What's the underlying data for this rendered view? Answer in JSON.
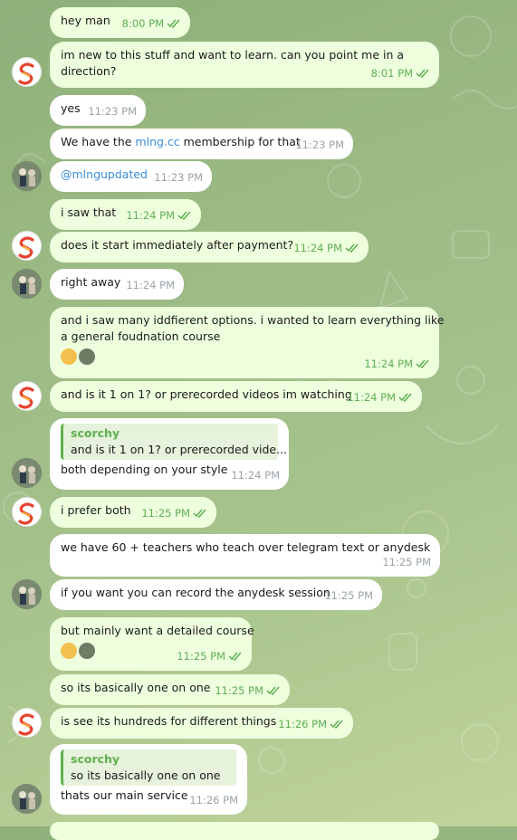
{
  "messages": [
    {
      "id": "m1",
      "dir": "out",
      "text": "hey man",
      "time": "8:00 PM"
    },
    {
      "id": "m2",
      "dir": "out",
      "text": "im new to this stuff and want to learn. can you point me in a direction?",
      "line1": "im new to this stuff and want to learn. can you point me in a",
      "line2": "direction?",
      "time": "8:01 PM"
    },
    {
      "id": "m3",
      "dir": "in",
      "text": "yes",
      "time": "11:23 PM"
    },
    {
      "id": "m4",
      "dir": "in",
      "pre": "We have the ",
      "link": "mlng.cc",
      "post": " membership for that",
      "time": "11:23 PM"
    },
    {
      "id": "m5",
      "dir": "in",
      "link": "@mlngupdated",
      "time": "11:23 PM"
    },
    {
      "id": "m6",
      "dir": "out",
      "text": "i saw that",
      "time": "11:24 PM"
    },
    {
      "id": "m7",
      "dir": "out",
      "text": "does it start immediately after payment?",
      "time": "11:24 PM"
    },
    {
      "id": "m8",
      "dir": "in",
      "text": "right away",
      "time": "11:24 PM"
    },
    {
      "id": "m9",
      "dir": "out",
      "line1": "and i saw many iddfierent options. i wanted to learn everything like",
      "line2": "a general foudnation course",
      "time": "11:24 PM"
    },
    {
      "id": "m10",
      "dir": "out",
      "text": "and is it 1 on 1? or prerecorded videos im watching",
      "time": "11:24 PM"
    },
    {
      "id": "m11",
      "dir": "in",
      "quote_name": "scorchy",
      "quote_text": "and is it 1 on 1? or prerecorded vide...",
      "text": "both depending on your style",
      "time": "11:24 PM"
    },
    {
      "id": "m12",
      "dir": "out",
      "text": "i prefer both",
      "time": "11:25 PM"
    },
    {
      "id": "m13",
      "dir": "in",
      "text": "we have 60 + teachers who teach over telegram text or anydesk",
      "time": "11:25 PM"
    },
    {
      "id": "m14",
      "dir": "in",
      "text": "if you want you can record the anydesk session",
      "time": "11:25 PM"
    },
    {
      "id": "m15",
      "dir": "out",
      "text": "but mainly want a detailed course",
      "time": "11:25 PM"
    },
    {
      "id": "m16",
      "dir": "out",
      "text": "so its basically one on one",
      "time": "11:25 PM"
    },
    {
      "id": "m17",
      "dir": "out",
      "text": "is see its hundreds for different things",
      "time": "11:26 PM"
    },
    {
      "id": "m18",
      "dir": "in",
      "quote_name": "scorchy",
      "quote_text": "so its basically one on one",
      "text": "thats our main service",
      "time": "11:26 PM"
    }
  ],
  "avatars": {
    "self_letter": "S"
  },
  "colors": {
    "out_bubble": "#eeffde",
    "in_bubble": "#ffffff",
    "accent": "#5fae55",
    "link": "#3b8fd6"
  }
}
